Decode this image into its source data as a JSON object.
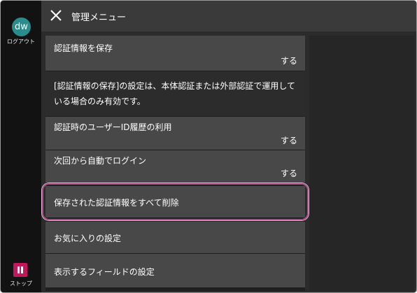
{
  "sidebar": {
    "avatar_initials": "dw",
    "logout_label": "ログアウト",
    "stop_label": "ストップ"
  },
  "header": {
    "title": "管理メニュー",
    "close_icon": "close-icon"
  },
  "menu": {
    "save_auth": {
      "label": "認証情報を保存",
      "value": "する"
    },
    "note": "[認証情報の保存]の設定は、本体認証または外部認証で運用している場合のみ有効です。",
    "user_id_history": {
      "label": "認証時のユーザーID履歴の利用",
      "value": "する"
    },
    "auto_login": {
      "label": "次回から自動でログイン",
      "value": "する"
    },
    "delete_saved": {
      "label": "保存された認証情報をすべて削除"
    },
    "favorites": {
      "label": "お気に入りの設定"
    },
    "display_fields": {
      "label": "表示するフィールドの設定"
    }
  },
  "colors": {
    "accent": "#b04a8a",
    "stop": "#c2185b",
    "avatar": "#2b8d8b"
  }
}
